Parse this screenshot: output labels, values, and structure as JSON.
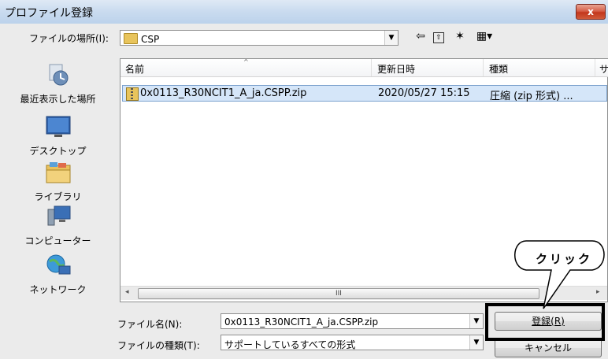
{
  "window": {
    "title": "プロファイル登録",
    "close_label": "x"
  },
  "lookin": {
    "label": "ファイルの場所(I):",
    "value": "CSP"
  },
  "toolbar": {
    "back_glyph": "⇦",
    "up_glyph": "⇧",
    "newfolder_glyph": "✶",
    "view_glyph": "▦▾"
  },
  "places": [
    {
      "name": "recent",
      "label": "最近表示した場所"
    },
    {
      "name": "desktop",
      "label": "デスクトップ"
    },
    {
      "name": "libraries",
      "label": "ライブラリ"
    },
    {
      "name": "computer",
      "label": "コンピューター"
    },
    {
      "name": "network",
      "label": "ネットワーク"
    }
  ],
  "columns": {
    "name": "名前",
    "modified": "更新日時",
    "type": "種類",
    "size": "サ"
  },
  "files": [
    {
      "name": "0x0113_R30NCIT1_A_ja.CSPP.zip",
      "modified": "2020/05/27 15:15",
      "type": "圧縮 (zip 形式) ..."
    }
  ],
  "scrollbar": {
    "grip": "III",
    "left": "◂",
    "right": "▸"
  },
  "filename": {
    "label": "ファイル名(N):",
    "value": "0x0113_R30NCIT1_A_ja.CSPP.zip"
  },
  "filetype": {
    "label": "ファイルの種類(T):",
    "value": "サポートしているすべての形式"
  },
  "buttons": {
    "register": "登録(R)",
    "cancel": "キャンセル"
  },
  "annotation": {
    "bubble_text": "クリック"
  },
  "colors": {
    "selection": "#d5e6f9",
    "titlebar": "#c9dbef",
    "close": "#c3361c"
  }
}
